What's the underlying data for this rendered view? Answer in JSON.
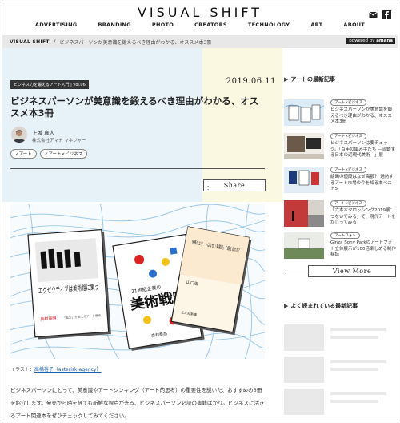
{
  "header": {
    "logo": "VISUAL SHIFT",
    "nav": [
      "ADVERTISING",
      "BRANDING",
      "PHOTO",
      "CREATORS",
      "TECHNOLOGY",
      "ART",
      "ABOUT"
    ]
  },
  "breadcrumb": {
    "home": "VISUAL SHIFT",
    "current": "ビジネスパーソンが美意識を鍛えるべき理由がわかる、オススメ本3冊",
    "powered_prefix": "powered by",
    "powered_brand": "amana"
  },
  "article": {
    "category_badge": "ビジネス力を鍛えるアート入門 | vol.06",
    "date": "2019.06.11",
    "title": "ビジネスパーソンが美意識を鍛えるべき理由がわかる、オススメ本3冊",
    "author_name": "上坂 真人",
    "author_org": "株式会社アマナ マネジャー",
    "tags": [
      "アート",
      "アート×ビジネス"
    ],
    "share_label": "Share",
    "credit_prefix": "イラスト：",
    "credit_link": "高橋裕子（asterisk-agency）",
    "body": "ビジネスパーソンにとって、美意識やアートシンキング（アート的思考）の重要性を説いた、おすすめの3冊を紹介します。発売から時を経ても新鮮な視点が光る、ビジネスパーソン必読の書籍ばかり。ビジネスに活きるアート関連本をぜひチェックしてみてください。",
    "books": {
      "book1_title": "エグゼクティブは美術館に集う",
      "book1_author": "奥村高明",
      "book1_sub": "「脳力」を鍛えるアート思考",
      "book2_small": "21世紀企業の",
      "book2_title": "美術戦略",
      "book2_author": "森村泰昌",
      "book3_title": "世界のエリートはなぜ「美意識」を鍛えるのか？",
      "book3_author": "山口周",
      "book3_imprint": "光文社新書"
    }
  },
  "sidebar": {
    "latest_heading": "アートの最新記事",
    "items": [
      {
        "tag": "アート×ビジネス",
        "text": "ビジネスパーソンが美意識を鍛えるべき理由がわかる、オススメ本3冊"
      },
      {
        "tag": "アート×ビジネス",
        "text": "ビジネスパーソンは要チェック。「百年の編み手たち —流動する日本の近現代美術—」展"
      },
      {
        "tag": "アート×ビジネス",
        "text": "絵画の値段はなぜ高額？ 過熱するアート市場の今を知る本ベスト5"
      },
      {
        "tag": "アート×ビジネス",
        "text": "「六本木クロッシング2019展：つないでみる」で、現代アートをかじってみる"
      },
      {
        "tag": "アートフォト",
        "text": "Ginza Sony Parkのアートフォト立体展示が100倍楽しめる制作秘話"
      }
    ],
    "view_more": "View More",
    "popular_heading": "よく読まれている最新記事"
  }
}
